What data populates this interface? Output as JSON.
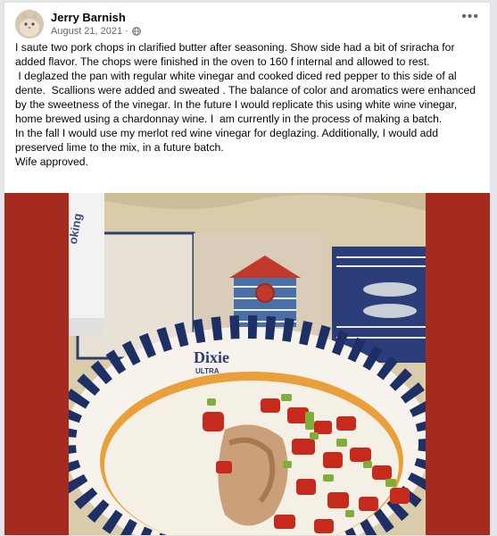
{
  "post": {
    "author": "Jerry Barnish",
    "date": "August 21, 2021 ·",
    "more_label": "•••",
    "paragraphs": [
      "I saute two pork chops in clarified butter after seasoning. Show side had a bit of sriracha for added flavor. The chops were finished in the oven to 160 f internal and allowed to rest.",
      " I deglazed the pan with regular white vinegar and cooked diced red pepper to this side of al dente.  Scallions were added and sweated . The balance of color and aromatics were enhanced by the sweetness of the vinegar. In the future I would replicate this using white wine vinegar,  home brewed using a chardonnay wine. I  am currently in the process of making a batch.",
      "In the fall I would use my merlot red wine vinegar for deglazing. Additionally, I would add preserved lime to the mix, in a future batch.",
      "Wife approved."
    ]
  },
  "photo": {
    "bottle_text": "oking\nasses",
    "plate_brand": "Dixie",
    "plate_sub": "ULTRA"
  },
  "colors": {
    "background": "#a52a1f",
    "name": "#050505",
    "meta": "#65676b"
  },
  "icons": [
    "avatar-cat-icon",
    "globe-icon",
    "more-options-icon"
  ]
}
